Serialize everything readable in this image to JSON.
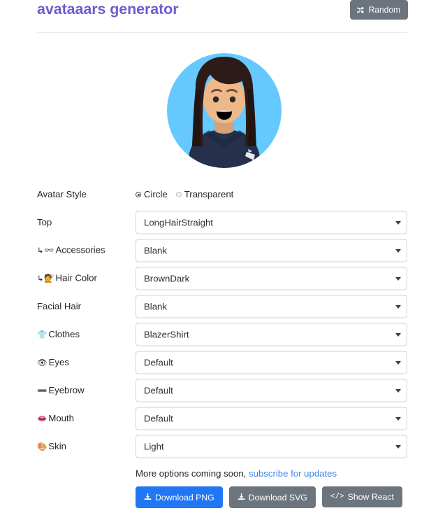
{
  "header": {
    "title": "avataaars generator",
    "random_button": {
      "label": "Random",
      "icon": "shuffle-icon",
      "glyph": "⤨"
    }
  },
  "avatar": {
    "alt": "avatar-preview",
    "background_color": "#65C9FF",
    "hair_color": "#2C1B18",
    "skin_color": "#EDB98A",
    "clothes_color": "#25314C"
  },
  "form": {
    "rows": [
      {
        "label": "Avatar Style",
        "icon": "",
        "prefix": "",
        "type": "radio",
        "options": [
          {
            "label": "Circle",
            "selected": true
          },
          {
            "label": "Transparent",
            "selected": false
          }
        ]
      },
      {
        "label": "Top",
        "icon": "",
        "prefix": "",
        "type": "select",
        "value": "LongHairStraight"
      },
      {
        "label": "Accessories",
        "icon": "👓",
        "prefix": "↳",
        "type": "select",
        "value": "Blank"
      },
      {
        "label": "Hair Color",
        "icon": "💇",
        "prefix": "↳",
        "type": "select",
        "value": "BrownDark"
      },
      {
        "label": "Facial Hair",
        "icon": "",
        "prefix": "",
        "type": "select",
        "value": "Blank"
      },
      {
        "label": "Clothes",
        "icon": "👕",
        "prefix": "",
        "type": "select",
        "value": "BlazerShirt"
      },
      {
        "label": "Eyes",
        "icon": "👁",
        "prefix": "",
        "type": "select",
        "value": "Default"
      },
      {
        "label": "Eyebrow",
        "icon": "➖",
        "prefix": "",
        "type": "select",
        "value": "Default"
      },
      {
        "label": "Mouth",
        "icon": "👄",
        "prefix": "",
        "type": "select",
        "value": "Default"
      },
      {
        "label": "Skin",
        "icon": "🎨",
        "prefix": "",
        "type": "select",
        "value": "Light"
      }
    ]
  },
  "footer": {
    "more_options_text": "More options coming soon,",
    "subscribe_link": "subscribe for updates",
    "buttons": [
      {
        "label": "Download PNG",
        "icon": "download-icon",
        "glyph": "⭳",
        "style": "primary"
      },
      {
        "label": "Download SVG",
        "icon": "download-icon",
        "glyph": "⭳",
        "style": "secondary"
      },
      {
        "label": "Show React",
        "icon": "code-icon",
        "glyph": "</>",
        "style": "secondary"
      }
    ]
  }
}
